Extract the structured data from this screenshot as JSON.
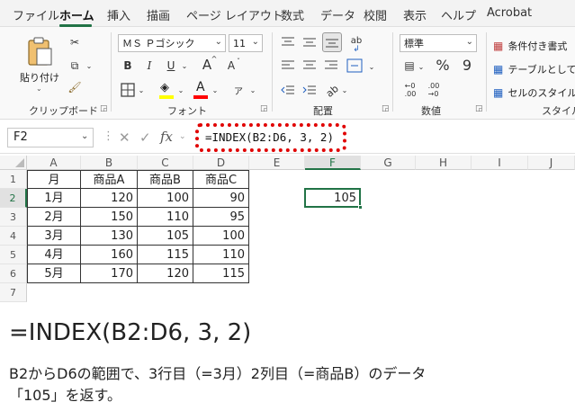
{
  "menu": {
    "items": [
      "ファイル",
      "ホーム",
      "挿入",
      "描画",
      "ページ レイアウト",
      "数式",
      "データ",
      "校閲",
      "表示",
      "ヘルプ",
      "Acrobat"
    ],
    "active": "ホーム"
  },
  "ribbon": {
    "clipboard": {
      "paste_label": "貼り付け",
      "group_label": "クリップボード"
    },
    "font": {
      "font_name": "ＭＳ Ｐゴシック",
      "font_size": "11",
      "bold": "B",
      "italic": "I",
      "underline": "U",
      "grow": "A",
      "shrink": "A",
      "font_color_letter": "A",
      "highlight_color": "#ffff00",
      "font_color": "#ff0000",
      "group_label": "フォント"
    },
    "alignment": {
      "wrap_label": "ab",
      "group_label": "配置"
    },
    "number": {
      "format": "標準",
      "percent": "%",
      "comma": "9",
      "group_label": "数値"
    },
    "styles": {
      "conditional_label": "条件付き書式",
      "table_label": "テーブルとして",
      "cell_style_label": "セルのスタイル",
      "group_label": "スタイル"
    }
  },
  "formula_bar": {
    "name_box": "F2",
    "formula": "=INDEX(B2:D6, 3, 2)",
    "highlight_color": "#e00000"
  },
  "sheet": {
    "columns": [
      "A",
      "B",
      "C",
      "D",
      "E",
      "F",
      "G",
      "H",
      "I",
      "J"
    ],
    "rows": [
      "1",
      "2",
      "3",
      "4",
      "5",
      "6",
      "7"
    ],
    "active_column": "F",
    "active_row": "2",
    "header": [
      "月",
      "商品A",
      "商品B",
      "商品C"
    ],
    "data": [
      [
        "1月",
        "120",
        "100",
        "90"
      ],
      [
        "2月",
        "150",
        "110",
        "95"
      ],
      [
        "3月",
        "130",
        "105",
        "100"
      ],
      [
        "4月",
        "160",
        "115",
        "110"
      ],
      [
        "5月",
        "170",
        "120",
        "115"
      ]
    ],
    "result_cell": "F2",
    "result_value": "105",
    "accent_color": "#217346"
  },
  "explanation": {
    "formula": "=INDEX(B2:D6, 3, 2)",
    "line1": "B2からD6の範囲で、3行目（=3月）2列目（=商品B）のデータ",
    "line2": "「105」を返す。"
  }
}
